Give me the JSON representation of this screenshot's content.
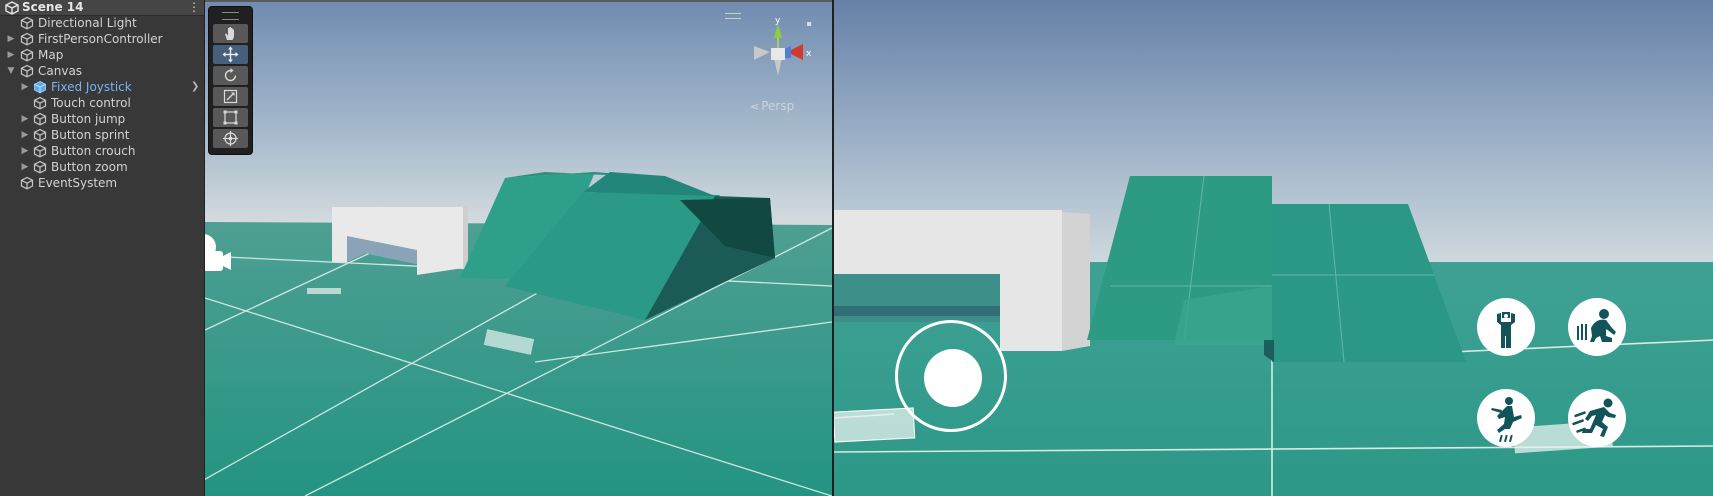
{
  "hierarchy": {
    "scene_title": "Scene 14",
    "items": [
      {
        "label": "Directional Light"
      },
      {
        "label": "FirstPersonController"
      },
      {
        "label": "Map"
      },
      {
        "label": "Canvas"
      },
      {
        "label": "Fixed Joystick"
      },
      {
        "label": "Touch control"
      },
      {
        "label": "Button jump"
      },
      {
        "label": "Button sprint"
      },
      {
        "label": "Button crouch"
      },
      {
        "label": "Button zoom"
      },
      {
        "label": "EventSystem"
      }
    ]
  },
  "scene_view": {
    "projection_label": "Persp",
    "gizmo_axes": {
      "y": "y",
      "x": "x"
    },
    "tools": [
      "hand-tool",
      "move-tool",
      "rotate-tool",
      "scale-tool",
      "rect-tool",
      "transform-tool"
    ],
    "active_tool": "move-tool"
  },
  "game_view": {
    "buttons": [
      "zoom",
      "crouch",
      "jump",
      "sprint"
    ]
  },
  "colors": {
    "ground": "#2e9a87",
    "ramp": "#2a9c88",
    "sky_top": "#6a87ad",
    "sky_bottom": "#c9d6dd",
    "selection_blue": "#7bb1f2",
    "icon_teal": "#13535a"
  }
}
